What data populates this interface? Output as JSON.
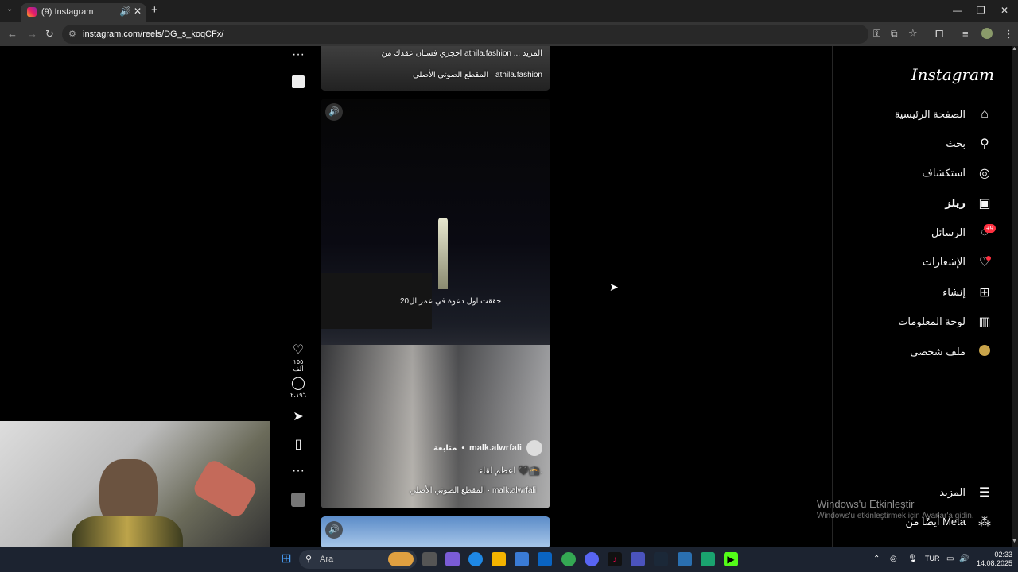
{
  "browser": {
    "tab_title": "(9) Instagram",
    "url": "instagram.com/reels/DG_s_koqCFx/"
  },
  "sidebar": {
    "logo": "Instagram",
    "items": [
      {
        "label": "الصفحة الرئيسية",
        "icon": "home-icon"
      },
      {
        "label": "بحث",
        "icon": "search-icon"
      },
      {
        "label": "استكشاف",
        "icon": "compass-icon"
      },
      {
        "label": "ريلز",
        "icon": "reels-icon"
      },
      {
        "label": "الرسائل",
        "icon": "messenger-icon",
        "badge": "+9"
      },
      {
        "label": "الإشعارات",
        "icon": "heart-icon"
      },
      {
        "label": "إنشاء",
        "icon": "plus-icon"
      },
      {
        "label": "لوحة المعلومات",
        "icon": "dashboard-icon"
      },
      {
        "label": "ملف شخصي",
        "icon": "avatar-icon"
      }
    ],
    "more": "المزيد",
    "also_from_meta": "أيضًا من Meta"
  },
  "reels": {
    "top": {
      "caption": "احجزي فستان عقدك من athila.fashion ... المزيد",
      "audio": "المقطع الصوتي الأصلي · athila.fashion"
    },
    "main": {
      "overlay_text": "حققت اول دعوة في عمر ال20",
      "username": "malk.alwrfali",
      "follow": "متابعة",
      "caption": "اعظم لقاء 🖤🕋.",
      "audio": "المقطع الصوتي الأصلي · malk.alwrfali",
      "likes": "١٥٥ ألف",
      "comments": "٢،١٩٦"
    }
  },
  "watermark": {
    "title": "Windows'u Etkinleştir",
    "subtitle": "Windows'u etkinleştirmek için Ayarlar'a gidin."
  },
  "taskbar": {
    "search_placeholder": "Ara",
    "language": "TUR",
    "time": "02:33",
    "date": "14.08.2025"
  }
}
